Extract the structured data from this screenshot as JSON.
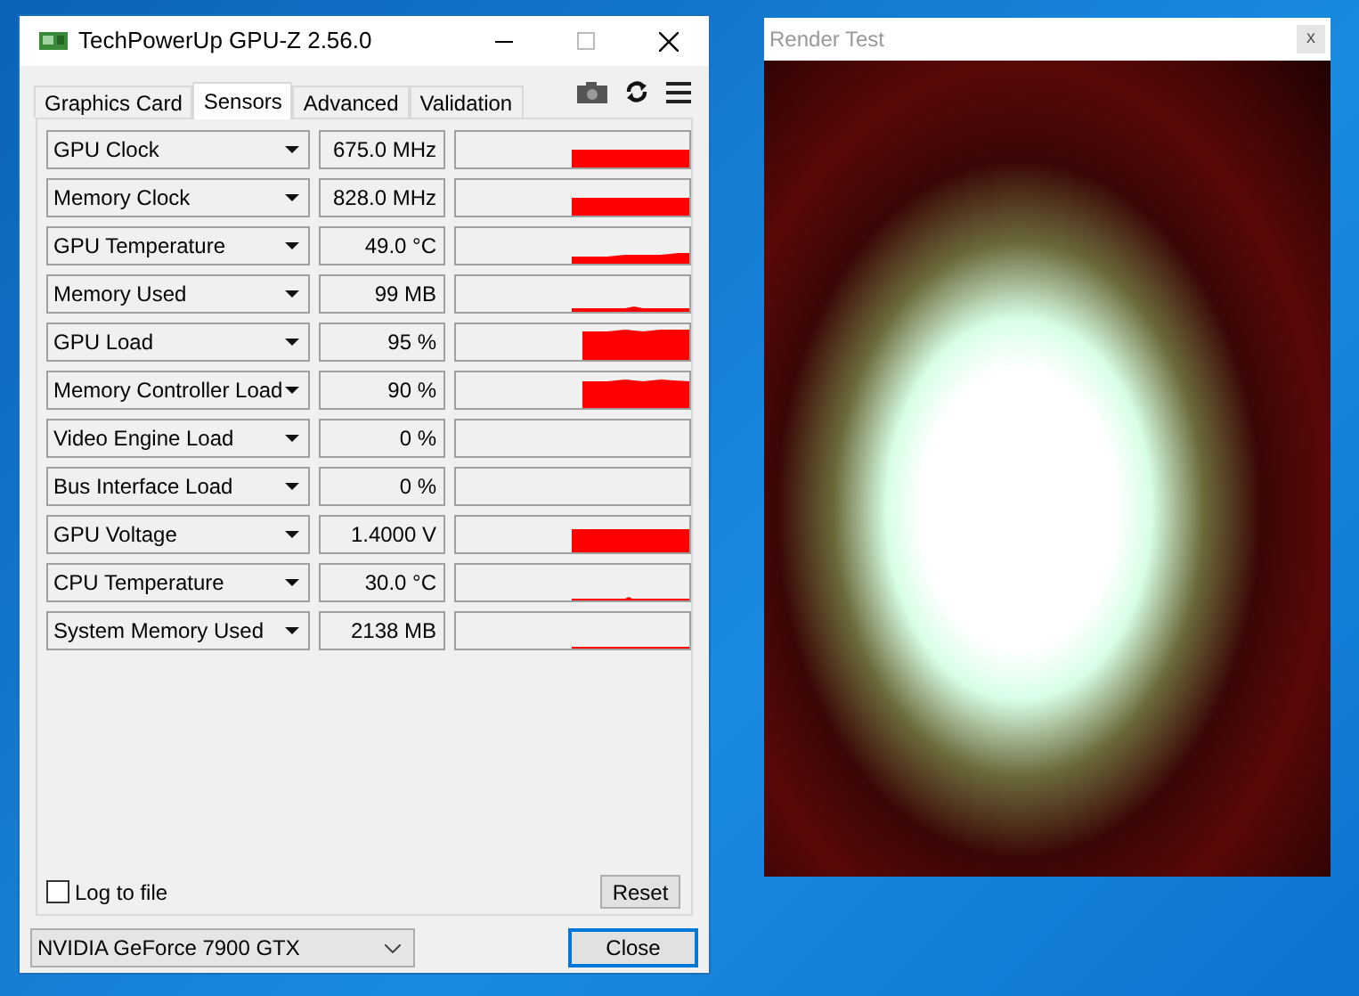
{
  "gpuz_window": {
    "title": "TechPowerUp GPU-Z 2.56.0",
    "tabs": [
      {
        "label": "Graphics Card",
        "selected": false
      },
      {
        "label": "Sensors",
        "selected": true
      },
      {
        "label": "Advanced",
        "selected": false
      },
      {
        "label": "Validation",
        "selected": false
      }
    ],
    "sensors": [
      {
        "name": "GPU Clock",
        "value": "675.0 MHz"
      },
      {
        "name": "Memory Clock",
        "value": "828.0 MHz"
      },
      {
        "name": "GPU Temperature",
        "value": "49.0 °C"
      },
      {
        "name": "Memory Used",
        "value": "99 MB"
      },
      {
        "name": "GPU Load",
        "value": "95 %"
      },
      {
        "name": "Memory Controller Load",
        "value": "90 %"
      },
      {
        "name": "Video Engine Load",
        "value": "0 %"
      },
      {
        "name": "Bus Interface Load",
        "value": "0 %"
      },
      {
        "name": "GPU Voltage",
        "value": "1.4000 V"
      },
      {
        "name": "CPU Temperature",
        "value": "30.0 °C"
      },
      {
        "name": "System Memory Used",
        "value": "2138 MB"
      }
    ],
    "log_to_file": {
      "label": "Log to file",
      "checked": false
    },
    "reset_button": "Reset",
    "device_select": {
      "value": "NVIDIA GeForce 7900 GTX"
    },
    "close_button": "Close"
  },
  "render_window": {
    "title": "Render Test",
    "close": "x"
  }
}
